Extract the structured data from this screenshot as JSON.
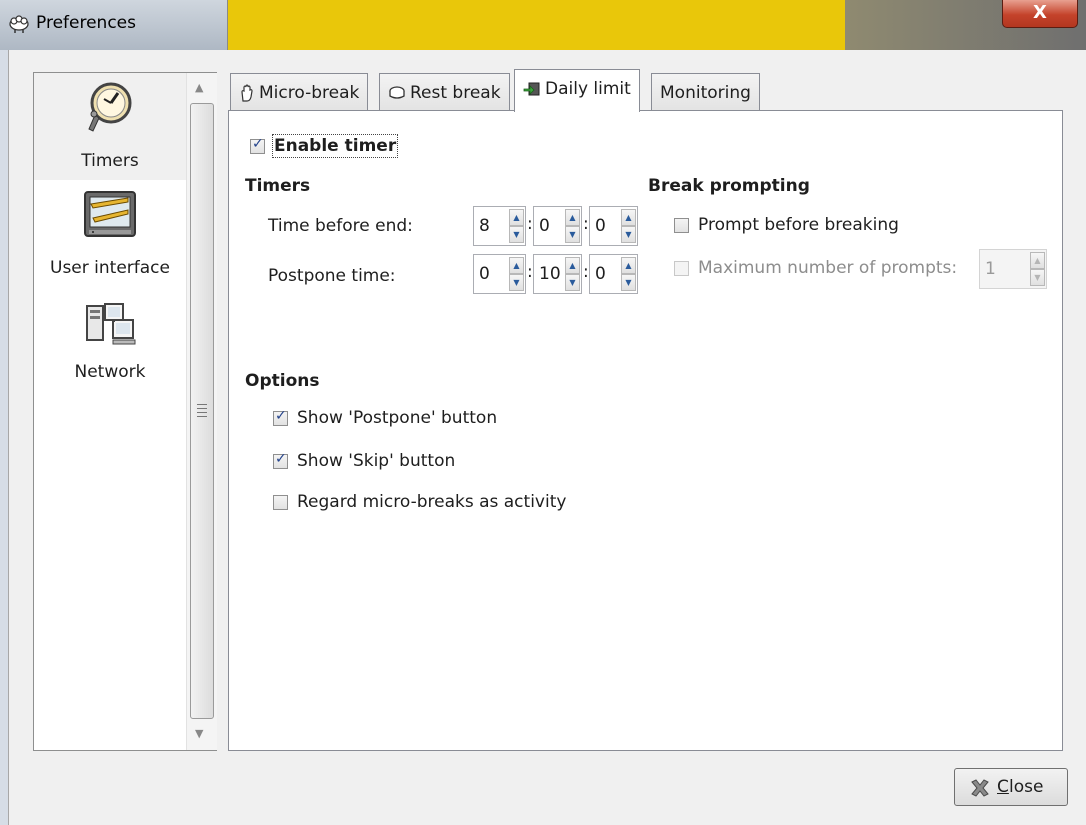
{
  "window": {
    "title": "Preferences",
    "close_glyph": "X"
  },
  "sidebar": {
    "items": [
      {
        "label": "Timers",
        "icon": "timers-icon",
        "selected": true
      },
      {
        "label": "User interface",
        "icon": "user-interface-icon",
        "selected": false
      },
      {
        "label": "Network",
        "icon": "network-icon",
        "selected": false
      }
    ]
  },
  "tabs": [
    {
      "label": "Micro-break",
      "icon": "hand-icon",
      "active": false
    },
    {
      "label": "Rest break",
      "icon": "bed-icon",
      "active": false
    },
    {
      "label": "Daily limit",
      "icon": "daily-limit-icon",
      "active": true
    },
    {
      "label": "Monitoring",
      "icon": "",
      "active": false
    }
  ],
  "panel": {
    "enable_timer": {
      "label": "Enable timer",
      "checked": true
    },
    "timers_heading": "Timers",
    "time_before_end": {
      "label": "Time before end:",
      "h": "8",
      "m": "0",
      "s": "0"
    },
    "postpone_time": {
      "label": "Postpone time:",
      "h": "0",
      "m": "10",
      "s": "0"
    },
    "break_prompting_heading": "Break prompting",
    "prompt_before_breaking": {
      "label": "Prompt before breaking",
      "checked": false
    },
    "max_prompts": {
      "label": "Maximum number of prompts:",
      "value": "1",
      "enabled": false
    },
    "options_heading": "Options",
    "options": [
      {
        "label": "Show 'Postpone' button",
        "checked": true
      },
      {
        "label": "Show 'Skip' button",
        "checked": true
      },
      {
        "label": "Regard micro-breaks as activity",
        "checked": false
      }
    ],
    "colon": ":"
  },
  "footer": {
    "close_label_first": "C",
    "close_label_rest": "lose"
  },
  "colors": {
    "title_accent": "#e9c70a",
    "close_red": "#c4432b",
    "check_blue": "#24438b"
  }
}
